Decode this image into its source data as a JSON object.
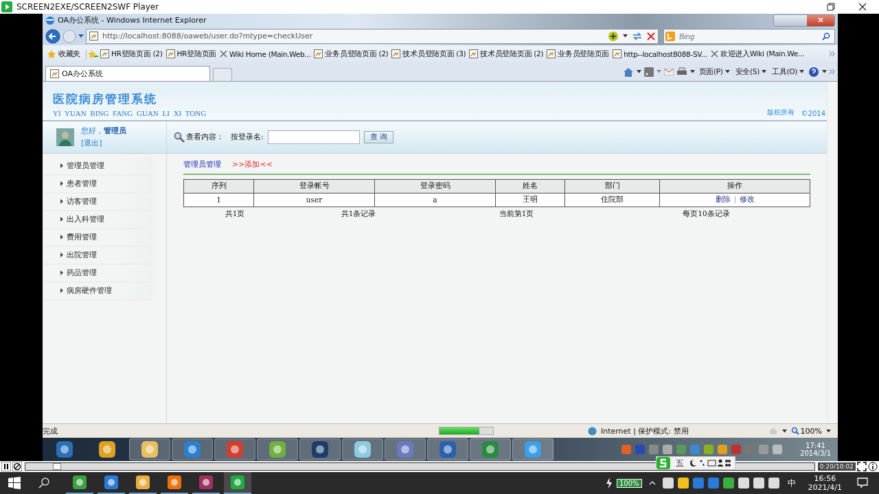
{
  "player": {
    "title": "SCREEN2EXE/SCREEN2SWF Player",
    "position": {
      "level": 0.035
    },
    "time": "0:20/10:02"
  },
  "browser": {
    "title": "OA办公系统 - Windows Internet Explorer",
    "address": "http://localhost:8088/oaweb/user.do?mtype=checkUser",
    "search_placeholder": "Bing",
    "favorites_label": "收藏夹",
    "favorites": [
      {
        "label": "HR登陆页面 (2)",
        "kind": "page"
      },
      {
        "label": "HR登陆页面",
        "kind": "page"
      },
      {
        "label": "Wiki Home (Main.Web...",
        "kind": "wiki"
      },
      {
        "label": "业务员登陆页面 (2)",
        "kind": "page"
      },
      {
        "label": "技术员登陆页面 (3)",
        "kind": "page"
      },
      {
        "label": "技术员登陆页面 (2)",
        "kind": "page"
      },
      {
        "label": "业务员登陆页面",
        "kind": "page"
      },
      {
        "label": "http--localhost8088-SV...",
        "kind": "page"
      },
      {
        "label": "欢迎进入Wiki (Main.We...",
        "kind": "wiki"
      }
    ],
    "tab": {
      "label": "OA办公系统",
      "selected": true
    },
    "commands": [
      "页面(P)",
      "安全(S)",
      "工具(O)"
    ],
    "status": "完成",
    "progress": {
      "level": 0.75
    },
    "zone": "Internet | 保护模式: 禁用",
    "zoom": "100%"
  },
  "page": {
    "title": "医院病房管理系统",
    "subtitle": "YI YUAN BING FANG GUAN LI XI TONG",
    "copyright": "版权所有",
    "year": "©2014",
    "greeting": "您好，",
    "user": "管理员",
    "logout": "[退出]",
    "menu": [
      "管理员管理",
      "患者管理",
      "访客管理",
      "出入科管理",
      "费用管理",
      "出院管理",
      "药品管理",
      "病房硬件管理"
    ],
    "search": {
      "label": "查看内容：",
      "field_label": "按登录名:",
      "button": "查 询"
    },
    "breadcrumb": "管理员管理",
    "add_link": ">>添加<<",
    "table": {
      "columns": [
        "序列",
        "登录帐号",
        "登录密码",
        "姓名",
        "部门",
        "操作"
      ],
      "rows": [
        {
          "cells": [
            "1",
            "user",
            "a",
            "王明",
            "住院部"
          ],
          "actions": [
            "删除",
            "修改"
          ]
        }
      ]
    },
    "pager": [
      "共1页",
      "共1条记录",
      "当前第1页",
      "每页10条记录"
    ]
  },
  "win7_taskbar": {
    "ime": "五",
    "time": "17:41",
    "date": "2014/3/1"
  },
  "win10_taskbar": {
    "battery": "100%",
    "ime": "中",
    "time": "16:56",
    "date": "2021/4/1"
  }
}
